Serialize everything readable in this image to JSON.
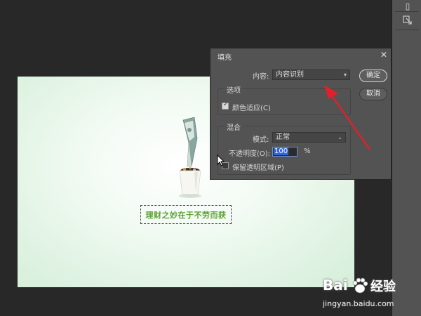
{
  "dialog": {
    "title": "填充",
    "content_label": "内容:",
    "content_value": "内容识别",
    "ok_label": "确定",
    "cancel_label": "取消",
    "options_group": "选项",
    "color_adapt_label": "颜色适应(C)",
    "color_adapt_checked": true,
    "blend_group": "混合",
    "mode_label": "模式:",
    "mode_value": "正常",
    "opacity_label": "不透明度(O):",
    "opacity_value": "100",
    "opacity_unit": "%",
    "preserve_transparency_label": "保留透明区域(P)",
    "preserve_transparency_checked": false
  },
  "canvas": {
    "caption": "理财之妙在于不劳而获"
  },
  "watermark": {
    "brand_left": "Bai",
    "brand_right": "经验",
    "url": "jingyan.baidu.com"
  },
  "colors": {
    "annotation_arrow": "#e0202a",
    "caption_text": "#5aa12e",
    "dialog_bg": "#535353",
    "workspace_bg": "#282828"
  }
}
